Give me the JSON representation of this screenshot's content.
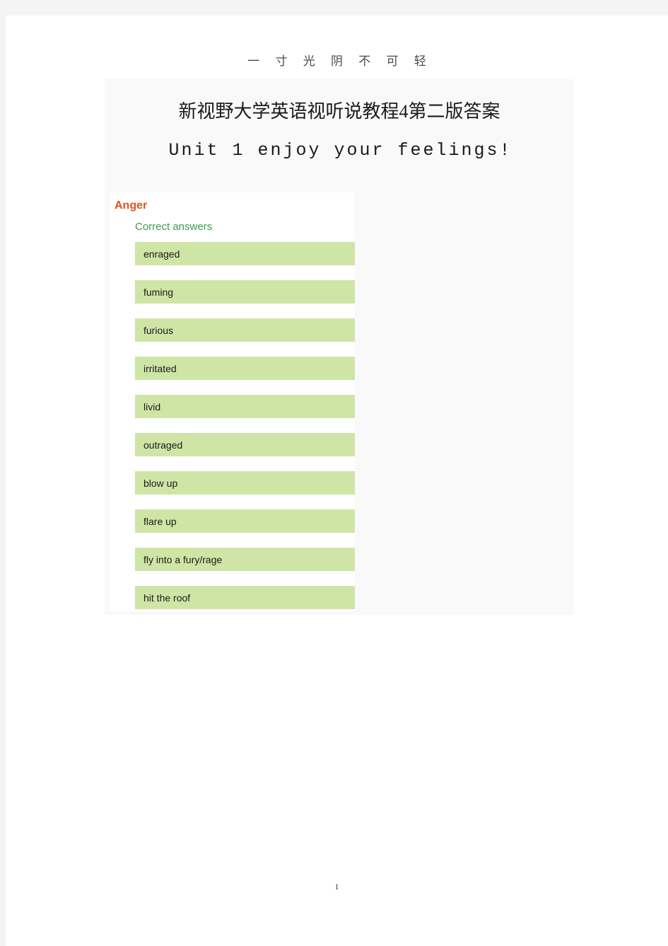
{
  "page": {
    "running_header": "一 寸 光 阴 不 可 轻",
    "page_number": "1",
    "colors": {
      "frame": "#f4f4f4",
      "paper": "#ffffff",
      "content_block_bg": "#f9f9f9",
      "group_title": "#e2521f",
      "answers_label": "#3f9a4d",
      "answer_chip_bg": "#cfe5a6",
      "answer_text": "#1b1b1b"
    }
  },
  "document": {
    "title": "新视野大学英语视听说教程4第二版答案",
    "subtitle": "Unit 1 enjoy your feelings!"
  },
  "answer_panel": {
    "group_title": "Anger",
    "answers_label": "Correct answers",
    "answers": [
      {
        "text": "enraged"
      },
      {
        "text": "fuming"
      },
      {
        "text": "furious"
      },
      {
        "text": "irritated"
      },
      {
        "text": "livid"
      },
      {
        "text": "outraged"
      },
      {
        "text": "blow up"
      },
      {
        "text": "flare up"
      },
      {
        "text": "fly into a fury/rage"
      },
      {
        "text": "hit the roof"
      }
    ]
  }
}
